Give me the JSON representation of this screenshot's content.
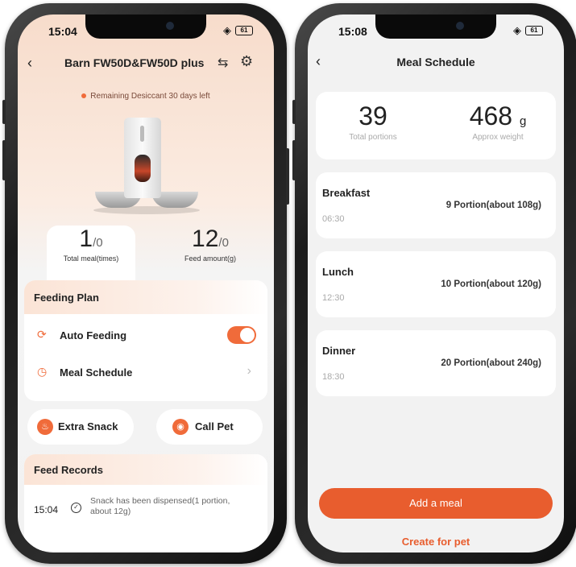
{
  "left_screen": {
    "status": {
      "time": "15:04",
      "battery": "61"
    },
    "header": {
      "device_name": "Barn FW50D&FW50D plus"
    },
    "desiccant_notice": "Remaining Desiccant 30 days left",
    "stats": {
      "total_meal": {
        "value": "1",
        "sub": "/0",
        "label": "Total meal(times)"
      },
      "feed_amount": {
        "value": "12",
        "sub": "/0",
        "label": "Feed amount(g)"
      }
    },
    "feeding_plan": {
      "title": "Feeding Plan",
      "auto_feeding": {
        "label": "Auto Feeding",
        "enabled": true
      },
      "meal_schedule": {
        "label": "Meal Schedule"
      }
    },
    "actions": {
      "extra_snack": "Extra Snack",
      "call_pet": "Call Pet"
    },
    "feed_records": {
      "title": "Feed Records",
      "items": [
        {
          "time": "15:04",
          "text": "Snack has been dispensed(1 portion, about 12g)"
        }
      ]
    }
  },
  "right_screen": {
    "status": {
      "time": "15:08",
      "battery": "61"
    },
    "title": "Meal Schedule",
    "summary": {
      "total_portions": {
        "value": "39",
        "label": "Total portions"
      },
      "approx_weight": {
        "value": "468",
        "unit": "g",
        "label": "Approx weight"
      }
    },
    "meals": [
      {
        "name": "Breakfast",
        "time": "06:30",
        "portion": "9 Portion(about 108g)"
      },
      {
        "name": "Lunch",
        "time": "12:30",
        "portion": "10 Portion(about 120g)"
      },
      {
        "name": "Dinner",
        "time": "18:30",
        "portion": "20 Portion(about 240g)"
      }
    ],
    "add_meal_label": "Add a meal",
    "create_for_pet_label": "Create for pet"
  },
  "colors": {
    "accent": "#f06b3a",
    "accent_dark": "#e85d2e",
    "background": "#f2f2f2"
  },
  "icons": [
    "back-icon",
    "adjust-icon",
    "gear-icon",
    "refresh-icon",
    "clock-icon",
    "chevron-right-icon",
    "snack-icon",
    "call-pet-icon",
    "check-circle-icon",
    "wifi-icon"
  ]
}
